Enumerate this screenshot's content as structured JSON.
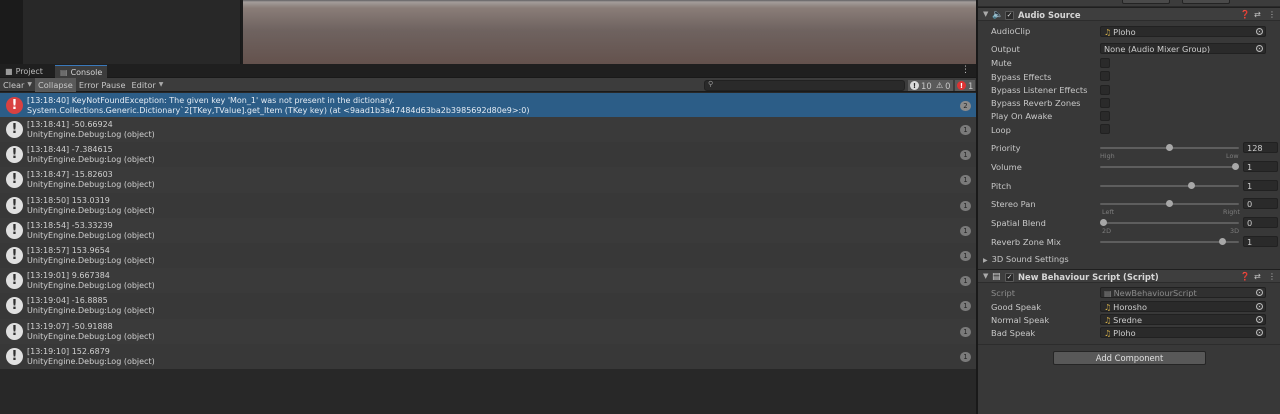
{
  "tabs": {
    "project": "Project",
    "console": "Console"
  },
  "toolbar": {
    "clear": "Clear",
    "collapse": "Collapse",
    "error_pause": "Error Pause",
    "editor": "Editor",
    "search_placeholder": "",
    "info_count": "10",
    "warning_count": "0",
    "error_count": "1"
  },
  "log": [
    {
      "type": "error",
      "line1": "[13:18:40] KeyNotFoundException: The given key 'Mon_1' was not present in the dictionary.",
      "line2": "System.Collections.Generic.Dictionary`2[TKey,TValue].get_Item (TKey key) (at <9aad1b3a47484d63ba2b3985692d80e9>:0)",
      "count": "2"
    },
    {
      "type": "info",
      "line1": "[13:18:41] -50.66924",
      "line2": "UnityEngine.Debug:Log (object)",
      "count": "1"
    },
    {
      "type": "info",
      "line1": "[13:18:44] -7.384615",
      "line2": "UnityEngine.Debug:Log (object)",
      "count": "1"
    },
    {
      "type": "info",
      "line1": "[13:18:47] -15.82603",
      "line2": "UnityEngine.Debug:Log (object)",
      "count": "1"
    },
    {
      "type": "info",
      "line1": "[13:18:50] 153.0319",
      "line2": "UnityEngine.Debug:Log (object)",
      "count": "1"
    },
    {
      "type": "info",
      "line1": "[13:18:54] -53.33239",
      "line2": "UnityEngine.Debug:Log (object)",
      "count": "1"
    },
    {
      "type": "info",
      "line1": "[13:18:57] 153.9654",
      "line2": "UnityEngine.Debug:Log (object)",
      "count": "1"
    },
    {
      "type": "info",
      "line1": "[13:19:01] 9.667384",
      "line2": "UnityEngine.Debug:Log (object)",
      "count": "1"
    },
    {
      "type": "info",
      "line1": "[13:19:04] -16.8885",
      "line2": "UnityEngine.Debug:Log (object)",
      "count": "1"
    },
    {
      "type": "info",
      "line1": "[13:19:07] -50.91888",
      "line2": "UnityEngine.Debug:Log (object)",
      "count": "1"
    },
    {
      "type": "info",
      "line1": "[13:19:10] 152.6879",
      "line2": "UnityEngine.Debug:Log (object)",
      "count": "1"
    }
  ],
  "audio_source": {
    "title": "Audio Source",
    "audio_clip_label": "AudioClip",
    "audio_clip_value": "Ploho",
    "output_label": "Output",
    "output_value": "None (Audio Mixer Group)",
    "mute": "Mute",
    "bypass_effects": "Bypass Effects",
    "bypass_listener_effects": "Bypass Listener Effects",
    "bypass_reverb_zones": "Bypass Reverb Zones",
    "play_on_awake": "Play On Awake",
    "loop": "Loop",
    "priority_label": "Priority",
    "priority_value": "128",
    "priority_level": 0.5,
    "priority_min": "High",
    "priority_max": "Low",
    "volume_label": "Volume",
    "volume_value": "1",
    "volume_level": 1.0,
    "pitch_label": "Pitch",
    "pitch_value": "1",
    "pitch_level": 0.67,
    "stereo_pan_label": "Stereo Pan",
    "stereo_pan_value": "0",
    "stereo_pan_level": 0.5,
    "stereo_pan_min": "Left",
    "stereo_pan_max": "Right",
    "spatial_blend_label": "Spatial Blend",
    "spatial_blend_value": "0",
    "spatial_blend_level": 0.0,
    "spatial_blend_min": "2D",
    "spatial_blend_max": "3D",
    "reverb_zone_mix_label": "Reverb Zone Mix",
    "reverb_zone_mix_value": "1",
    "reverb_zone_mix_level": 0.9,
    "sound_settings": "3D Sound Settings"
  },
  "behaviour": {
    "title": "New Behaviour Script (Script)",
    "script_label": "Script",
    "script_value": "NewBehaviourScript",
    "good_label": "Good Speak",
    "good_value": "Horosho",
    "normal_label": "Normal Speak",
    "normal_value": "Sredne",
    "bad_label": "Bad Speak",
    "bad_value": "Ploho"
  },
  "add_component": "Add Component",
  "colors": {
    "selection": "#2c5d87",
    "error_icon": "#d94141",
    "tab_accent": "#3a79bb"
  }
}
